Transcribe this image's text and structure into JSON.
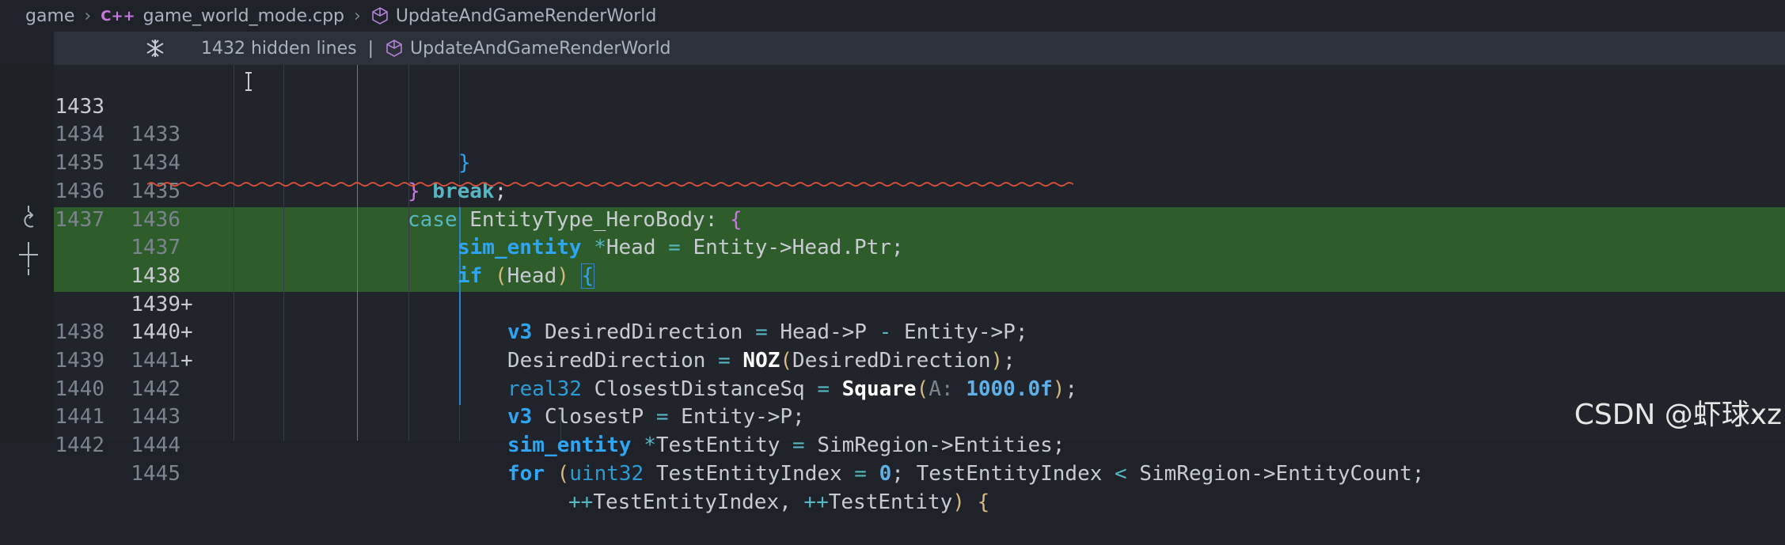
{
  "breadcrumb": {
    "items": [
      "game",
      "game_world_mode.cpp",
      "UpdateAndGameRenderWorld"
    ],
    "cpp_badge": "C++"
  },
  "sticky": {
    "hidden_lines": "1432 hidden lines",
    "separator": "|",
    "symbol": "UpdateAndGameRenderWorld"
  },
  "gutter": {
    "revert_icon": "revert-icon",
    "add_icon": "plus-icon"
  },
  "lines": [
    {
      "old": "1433",
      "new": "1433",
      "plus": ""
    },
    {
      "old": "1434",
      "new": "1434",
      "plus": ""
    },
    {
      "old": "1435",
      "new": "1435",
      "plus": ""
    },
    {
      "old": "1436",
      "new": "1436",
      "plus": ""
    },
    {
      "old": "1437",
      "new": "1437",
      "plus": ""
    },
    {
      "old": "",
      "new": "1438",
      "plus": "+"
    },
    {
      "old": "",
      "new": "1439",
      "plus": "+"
    },
    {
      "old": "",
      "new": "1440",
      "plus": "+"
    },
    {
      "old": "1438",
      "new": "1441",
      "plus": ""
    },
    {
      "old": "1439",
      "new": "1442",
      "plus": ""
    },
    {
      "old": "1440",
      "new": "1443",
      "plus": ""
    },
    {
      "old": "1441",
      "new": "1444",
      "plus": ""
    },
    {
      "old": "1442",
      "new": "1445",
      "plus": ""
    }
  ],
  "code": {
    "l0": {
      "a": "}"
    },
    "l1": {
      "a": "}",
      "b": " break",
      "c": ";"
    },
    "l2": {
      "a": "case",
      "b": " EntityType_HeroBody",
      "c": ": ",
      "d": "{"
    },
    "l3": {
      "a": "sim_entity",
      "b": " *",
      "c": "Head",
      "d": " = ",
      "e": "Entity->Head.Ptr;"
    },
    "l4": {
      "a": "if",
      "b": " (",
      "c": "Head",
      "d": ") ",
      "e": "{"
    },
    "l5": {
      "a": "v3",
      "b": " DesiredDirection",
      "c": " = ",
      "d": "Head->P",
      "e": " - ",
      "f": "Entity->P;"
    },
    "l6": {
      "a": "DesiredDirection",
      "b": " = ",
      "c": "NOZ",
      "d": "(",
      "e": "DesiredDirection",
      "f": ")",
      "g": ";"
    },
    "l8": {
      "a": "real32",
      "b": " ClosestDistanceSq",
      "c": " = ",
      "d": "Square",
      "e": "(",
      "f": "A:",
      "g": " 1000.0f",
      "h": ")",
      "i": ";"
    },
    "l9": {
      "a": "v3",
      "b": " ClosestP",
      "c": " = ",
      "d": "Entity->P;"
    },
    "l10": {
      "a": "sim_entity",
      "b": " *",
      "c": "TestEntity",
      "d": " = ",
      "e": "SimRegion->Entities;"
    },
    "l11": {
      "a": "for",
      "b": " (",
      "c": "uint32",
      "d": " TestEntityIndex",
      "e": " = ",
      "f": "0",
      "g": "; ",
      "h": "TestEntityIndex",
      "i": " < ",
      "j": "SimRegion->EntityCount;"
    },
    "l12": {
      "a": "++",
      "b": "TestEntityIndex, ",
      "c": "++",
      "d": "TestEntity",
      "e": ") ",
      "f": "{"
    }
  },
  "watermark": "CSDN @虾球xz",
  "colors": {
    "added_background": "#2f5c2b",
    "editor_background": "#21252b",
    "keyword": "#56b6c2",
    "type": "#2ea6f5"
  }
}
